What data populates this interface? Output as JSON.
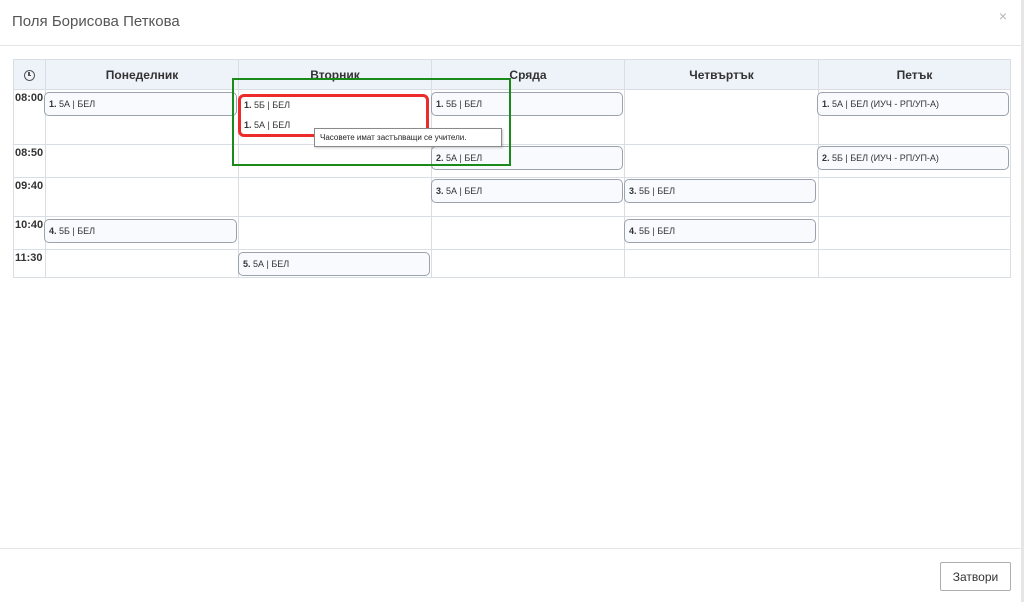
{
  "modal": {
    "title": "Поля Борисова Петкова",
    "close_icon": "×"
  },
  "table": {
    "days": [
      "Понеделник",
      "Вторник",
      "Сряда",
      "Четвъртък",
      "Петък"
    ],
    "times": [
      "08:00",
      "08:50",
      "09:40",
      "10:40",
      "11:30"
    ]
  },
  "lessons": {
    "mon_1": {
      "num": "1.",
      "text": " 5А | БЕЛ"
    },
    "tue_1a": {
      "num": "1.",
      "text": " 5Б | БЕЛ"
    },
    "tue_1b": {
      "num": "1.",
      "text": " 5А | БЕЛ"
    },
    "wed_1": {
      "num": "1.",
      "text": " 5Б | БЕЛ"
    },
    "fri_1": {
      "num": "1.",
      "text": " 5А | БЕЛ (ИУЧ - РП/УП-А)"
    },
    "wed_2": {
      "num": "2.",
      "text": " 5А | БЕЛ"
    },
    "fri_2": {
      "num": "2.",
      "text": " 5Б | БЕЛ (ИУЧ - РП/УП-А)"
    },
    "wed_3": {
      "num": "3.",
      "text": " 5А | БЕЛ"
    },
    "thu_3": {
      "num": "3.",
      "text": " 5Б | БЕЛ"
    },
    "mon_4": {
      "num": "4.",
      "text": " 5Б | БЕЛ"
    },
    "thu_4": {
      "num": "4.",
      "text": " 5Б | БЕЛ"
    },
    "tue_5": {
      "num": "5.",
      "text": " 5А | БЕЛ"
    }
  },
  "tooltip": {
    "text": "Часовете имат застъпващи се учители."
  },
  "footer": {
    "close_label": "Затвори"
  },
  "icons": {
    "header_time": "clock-icon",
    "close": "close-icon"
  },
  "colors": {
    "conflict_highlight": "#ee2b2b",
    "selection_box": "#1a8a1a",
    "header_bg": "#eef3fa"
  }
}
